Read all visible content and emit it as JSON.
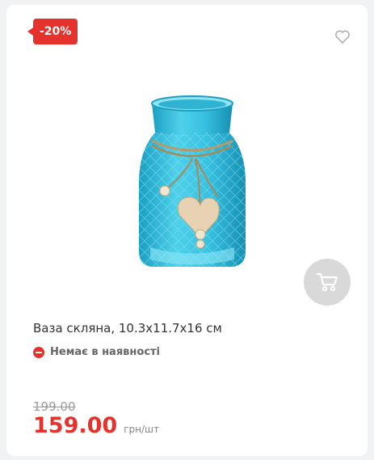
{
  "product": {
    "discount_badge": "-20%",
    "title": "Ваза скляна, 10.3x11.7x16 см",
    "stock_status": "Немає в наявності",
    "old_price": "199.00",
    "new_price": "159.00",
    "unit": "грн/шт"
  },
  "icons": {
    "favorite": "heart-outline-icon",
    "cart": "shopping-cart-icon",
    "stock": "minus-circle-icon"
  },
  "colors": {
    "accent": "#e5322d",
    "cart_button": "#d9d9d9",
    "vase": "#2fb7d6"
  }
}
